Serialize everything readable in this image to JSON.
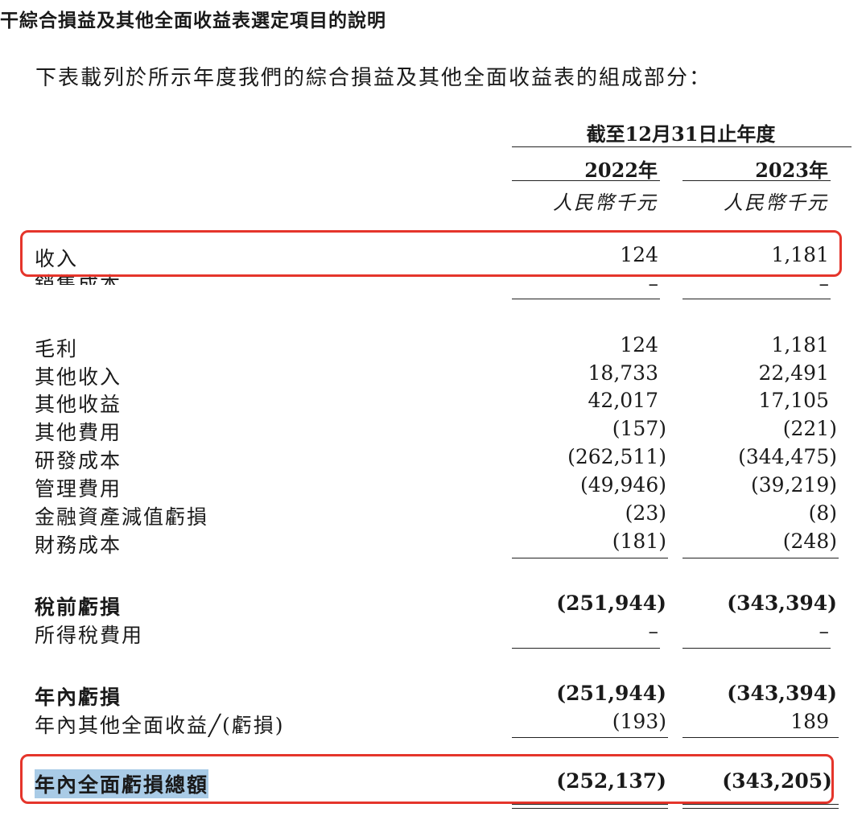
{
  "heading": "干綜合損益及其他全面收益表選定項目的說明",
  "intro": "下表載列於所示年度我們的綜合損益及其他全面收益表的組成部分：",
  "table": {
    "period_header": "截至12月31日止年度",
    "years": [
      "2022年",
      "2023年"
    ],
    "units": [
      "人民幣千元",
      "人民幣千元"
    ],
    "rows": [
      {
        "label": "收入",
        "v2022": "124",
        "v2023": "1,181"
      },
      {
        "label": "銷售成本",
        "v2022": "–",
        "v2023": "–"
      },
      {
        "label": "毛利",
        "v2022": "124",
        "v2023": "1,181"
      },
      {
        "label": "其他收入",
        "v2022": "18,733",
        "v2023": "22,491"
      },
      {
        "label": "其他收益",
        "v2022": "42,017",
        "v2023": "17,105"
      },
      {
        "label": "其他費用",
        "v2022": "(157)",
        "v2023": "(221)"
      },
      {
        "label": "研發成本",
        "v2022": "(262,511)",
        "v2023": "(344,475)"
      },
      {
        "label": "管理費用",
        "v2022": "(49,946)",
        "v2023": "(39,219)"
      },
      {
        "label": "金融資產減值虧損",
        "v2022": "(23)",
        "v2023": "(8)"
      },
      {
        "label": "財務成本",
        "v2022": "(181)",
        "v2023": "(248)"
      },
      {
        "label": "稅前虧損",
        "v2022": "(251,944)",
        "v2023": "(343,394)"
      },
      {
        "label": "所得稅費用",
        "v2022": "–",
        "v2023": "–"
      },
      {
        "label": "年內虧損",
        "v2022": "(251,944)",
        "v2023": "(343,394)"
      },
      {
        "label": "年內其他全面收益╱(虧損)",
        "v2022": "(193)",
        "v2023": "189"
      },
      {
        "label": "年內全面虧損總額",
        "v2022": "(252,137)",
        "v2023": "(343,205)"
      }
    ]
  },
  "highlight_color": "#e5352b"
}
